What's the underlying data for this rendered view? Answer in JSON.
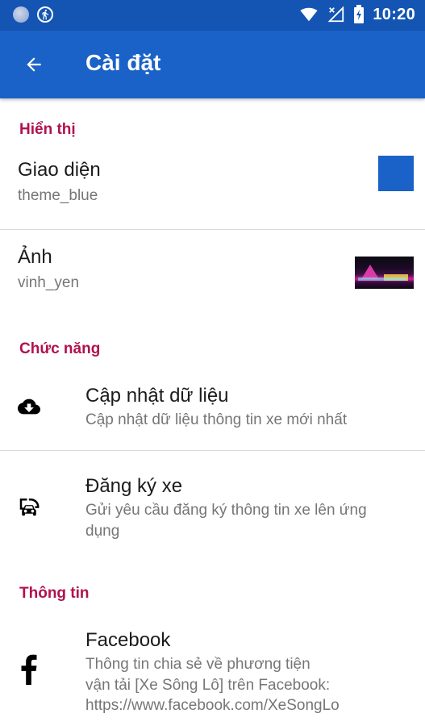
{
  "status_bar": {
    "time": "10:20",
    "icons": [
      "moon-icon",
      "running-icon",
      "wifi-icon",
      "no-signal-icon",
      "battery-charging-icon"
    ]
  },
  "app_bar": {
    "title": "Cài đặt",
    "back_icon": "arrow-back-icon"
  },
  "sections": {
    "display": {
      "header": "Hiển thị"
    },
    "functions": {
      "header": "Chức năng"
    },
    "info": {
      "header": "Thông tin"
    }
  },
  "prefs": {
    "theme": {
      "title": "Giao diện",
      "summary": "theme_blue",
      "swatch_color": "#1a62c7"
    },
    "image": {
      "title": "Ảnh",
      "summary": "vinh_yen"
    },
    "update_data": {
      "title": "Cập nhật dữ liệu",
      "summary": "Cập nhật dữ liệu thông tin xe mới nhất",
      "icon": "cloud-download-icon"
    },
    "register_vehicle": {
      "title": "Đăng ký xe",
      "summary_line1": "Gửi yêu cầu đăng ký thông tin xe lên ứng",
      "summary_line2": "dụng",
      "icon": "car-bus-icon"
    },
    "facebook": {
      "title": "Facebook",
      "summary_line1": "Thông tin chia sẻ về phương tiện",
      "summary_line2": "vận tải [Xe Sông Lô] trên Facebook:",
      "summary_line3": "https://www.facebook.com/XeSongLo",
      "icon": "facebook-icon"
    }
  },
  "colors": {
    "status_bar": "#1455b4",
    "app_bar": "#1a62c7",
    "section_header": "#b0124e"
  }
}
